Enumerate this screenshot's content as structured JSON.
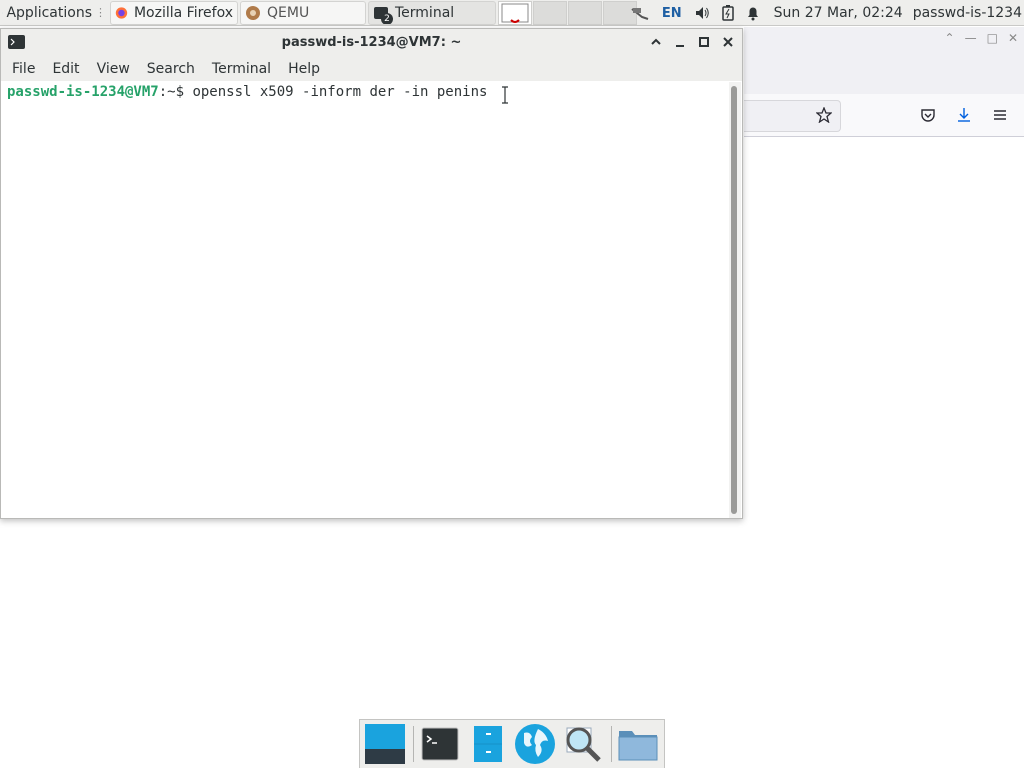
{
  "panel": {
    "applications_label": "Applications",
    "tasks": [
      {
        "label": "Mozilla Firefox",
        "icon": "firefox-icon",
        "active": false
      },
      {
        "label": "QEMU",
        "icon": "qemu-icon",
        "active": false
      },
      {
        "label": "Terminal",
        "icon": "terminal-icon",
        "badge": "2",
        "active": true
      }
    ],
    "keyboard_layout": "EN",
    "clock": "Sun 27 Mar, 02:24",
    "user": "passwd-is-1234"
  },
  "terminal": {
    "title": "passwd-is-1234@VM7: ~",
    "menu": [
      "File",
      "Edit",
      "View",
      "Search",
      "Terminal",
      "Help"
    ],
    "prompt_user": "passwd-is-1234@VM7",
    "prompt_sep": ":~$ ",
    "command": "openssl x509 -inform der -in penins"
  },
  "dock": {
    "items": [
      "show-desktop-icon",
      "terminal-icon",
      "file-manager-icon",
      "web-browser-icon",
      "app-finder-icon",
      "folder-icon"
    ]
  },
  "colors": {
    "prompt_green": "#26a269",
    "panel_bg": "#eeeeec",
    "accent_blue": "#1aa3de"
  }
}
